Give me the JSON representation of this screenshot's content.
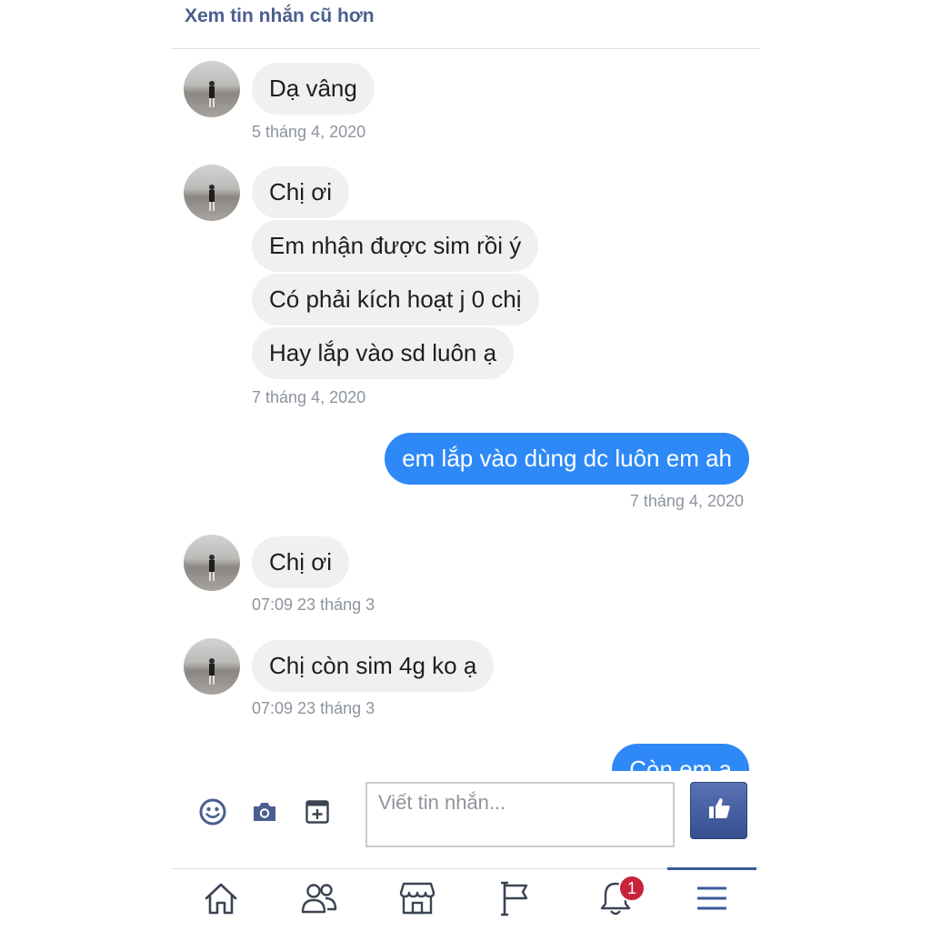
{
  "thread": {
    "older_messages_link": "Xem tin nhắn cũ hơn",
    "groups": [
      {
        "sender": "contact",
        "messages": [
          "Dạ vâng"
        ],
        "timestamp": "5 tháng 4, 2020"
      },
      {
        "sender": "contact",
        "messages": [
          "Chị ơi",
          "Em nhận được sim rồi ý",
          "Có phải kích hoạt j 0 chị",
          "Hay lắp vào sd luôn ạ"
        ],
        "timestamp": "7 tháng 4, 2020"
      },
      {
        "sender": "me",
        "messages": [
          "em lắp vào dùng dc luôn em ah"
        ],
        "timestamp": "7 tháng 4, 2020"
      },
      {
        "sender": "contact",
        "messages": [
          "Chị ơi"
        ],
        "timestamp": "07:09 23 tháng 3"
      },
      {
        "sender": "contact",
        "messages": [
          "Chị còn sim 4g ko ạ"
        ],
        "timestamp": "07:09 23 tháng 3"
      },
      {
        "sender": "me",
        "messages": [
          "Còn em ạ"
        ]
      }
    ]
  },
  "composer": {
    "placeholder": "Viết tin nhắn...",
    "icons": [
      "smiley-icon",
      "camera-icon",
      "sticker-add-icon"
    ],
    "send_icon": "thumbs-up-icon"
  },
  "navbar": {
    "items": [
      "home-icon",
      "friends-icon",
      "marketplace-icon",
      "pages-flag-icon",
      "notifications-bell-icon",
      "menu-icon"
    ],
    "active": "menu-icon",
    "notifications_badge": "1"
  },
  "colors": {
    "outgoing_bubble": "#2e89f7",
    "incoming_bubble": "#f1f0f0",
    "brand_blue": "#4b5f8f",
    "timestamp": "#8d949e",
    "badge_red": "#c8233a"
  }
}
